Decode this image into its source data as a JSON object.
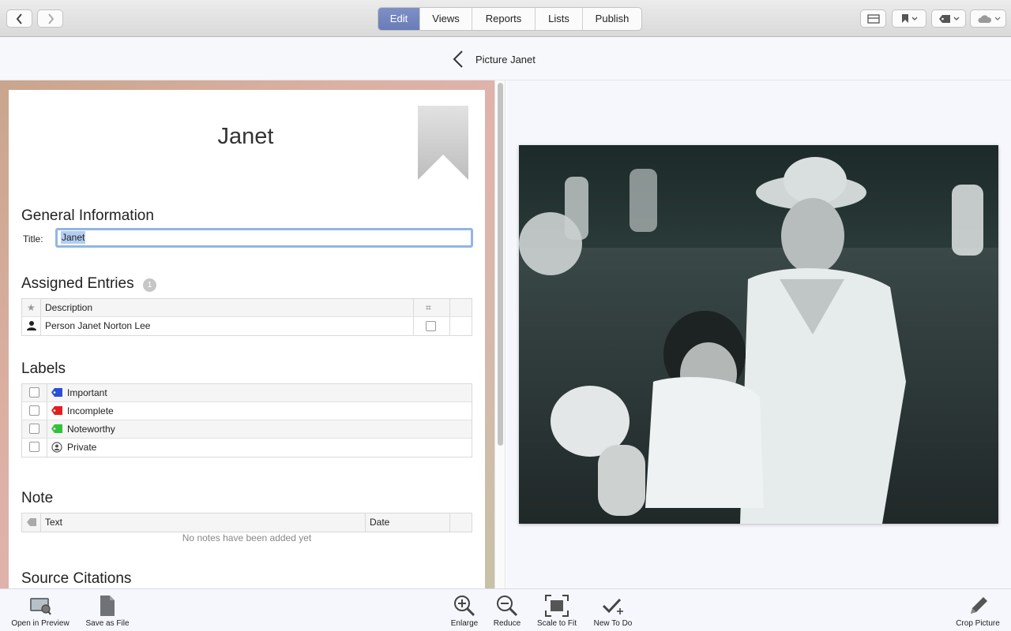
{
  "toolbar": {
    "tabs": [
      "Edit",
      "Views",
      "Reports",
      "Lists",
      "Publish"
    ],
    "active_tab": "Edit",
    "accent_color": "#6f81bd"
  },
  "header": {
    "title": "Picture Janet"
  },
  "person": {
    "name": "Janet"
  },
  "general": {
    "heading": "General Information",
    "title_label": "Title:",
    "title_value": "Janet"
  },
  "assigned": {
    "heading": "Assigned Entries",
    "count": "1",
    "columns": {
      "description": "Description",
      "hash": "⌗"
    },
    "rows": [
      {
        "description": "Person Janet Norton Lee",
        "icon": "person-icon"
      }
    ]
  },
  "labels": {
    "heading": "Labels",
    "items": [
      {
        "label": "Important",
        "color": "#2a4fd8"
      },
      {
        "label": "Incomplete",
        "color": "#e02020"
      },
      {
        "label": "Noteworthy",
        "color": "#2fc23a"
      },
      {
        "label": "Private",
        "color": "#666666"
      }
    ]
  },
  "note": {
    "heading": "Note",
    "columns": {
      "text": "Text",
      "date": "Date"
    },
    "empty_message": "No notes have been added yet"
  },
  "sources": {
    "heading": "Source Citations"
  },
  "bottom": {
    "open_preview": "Open in Preview",
    "save_file": "Save as File",
    "enlarge": "Enlarge",
    "reduce": "Reduce",
    "scale_fit": "Scale to Fit",
    "new_todo": "New To Do",
    "crop": "Crop Picture"
  }
}
